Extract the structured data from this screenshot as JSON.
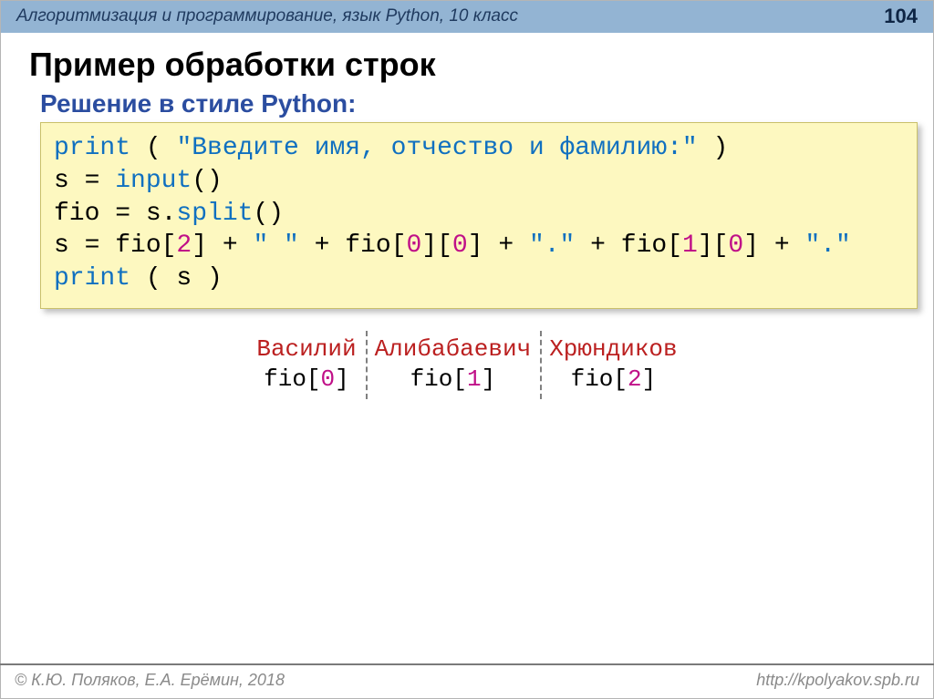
{
  "header": {
    "course": "Алгоритмизация и программирование, язык Python, 10 класс",
    "slide": "104"
  },
  "title": "Пример обработки строк",
  "subtitle": "Решение в стиле Python:",
  "code": {
    "l1": {
      "kw1": "print",
      "t1": " ( ",
      "str": "\"Введите имя, отчество и фамилию:\"",
      "t2": " )"
    },
    "l2": {
      "t1": "s = ",
      "kw1": "input",
      "t2": "()"
    },
    "l3": {
      "t1": "fio = s.",
      "kw1": "split",
      "t2": "()"
    },
    "l4": {
      "t1": "s = fio[",
      "n1": "2",
      "t2": "] + ",
      "s1": "\" \"",
      "t3": " + fio[",
      "n2": "0",
      "t4": "][",
      "n3": "0",
      "t5": "] + ",
      "s2": "\".\"",
      "t6": " + fio[",
      "n4": "1",
      "t7": "][",
      "n5": "0",
      "t8": "] + ",
      "s3": "\".\""
    },
    "l5": {
      "kw1": "print",
      "t1": " ( s )"
    }
  },
  "fio": {
    "cols": [
      {
        "name": "Василий",
        "var_pre": "fio[",
        "idx": "0",
        "var_post": "]"
      },
      {
        "name": "Алибабаевич",
        "var_pre": "fio[",
        "idx": "1",
        "var_post": "]"
      },
      {
        "name": "Хрюндиков",
        "var_pre": "fio[",
        "idx": "2",
        "var_post": "]"
      }
    ]
  },
  "footer": {
    "left": "© К.Ю. Поляков, Е.А. Ерёмин, 2018",
    "right": "http://kpolyakov.spb.ru"
  }
}
